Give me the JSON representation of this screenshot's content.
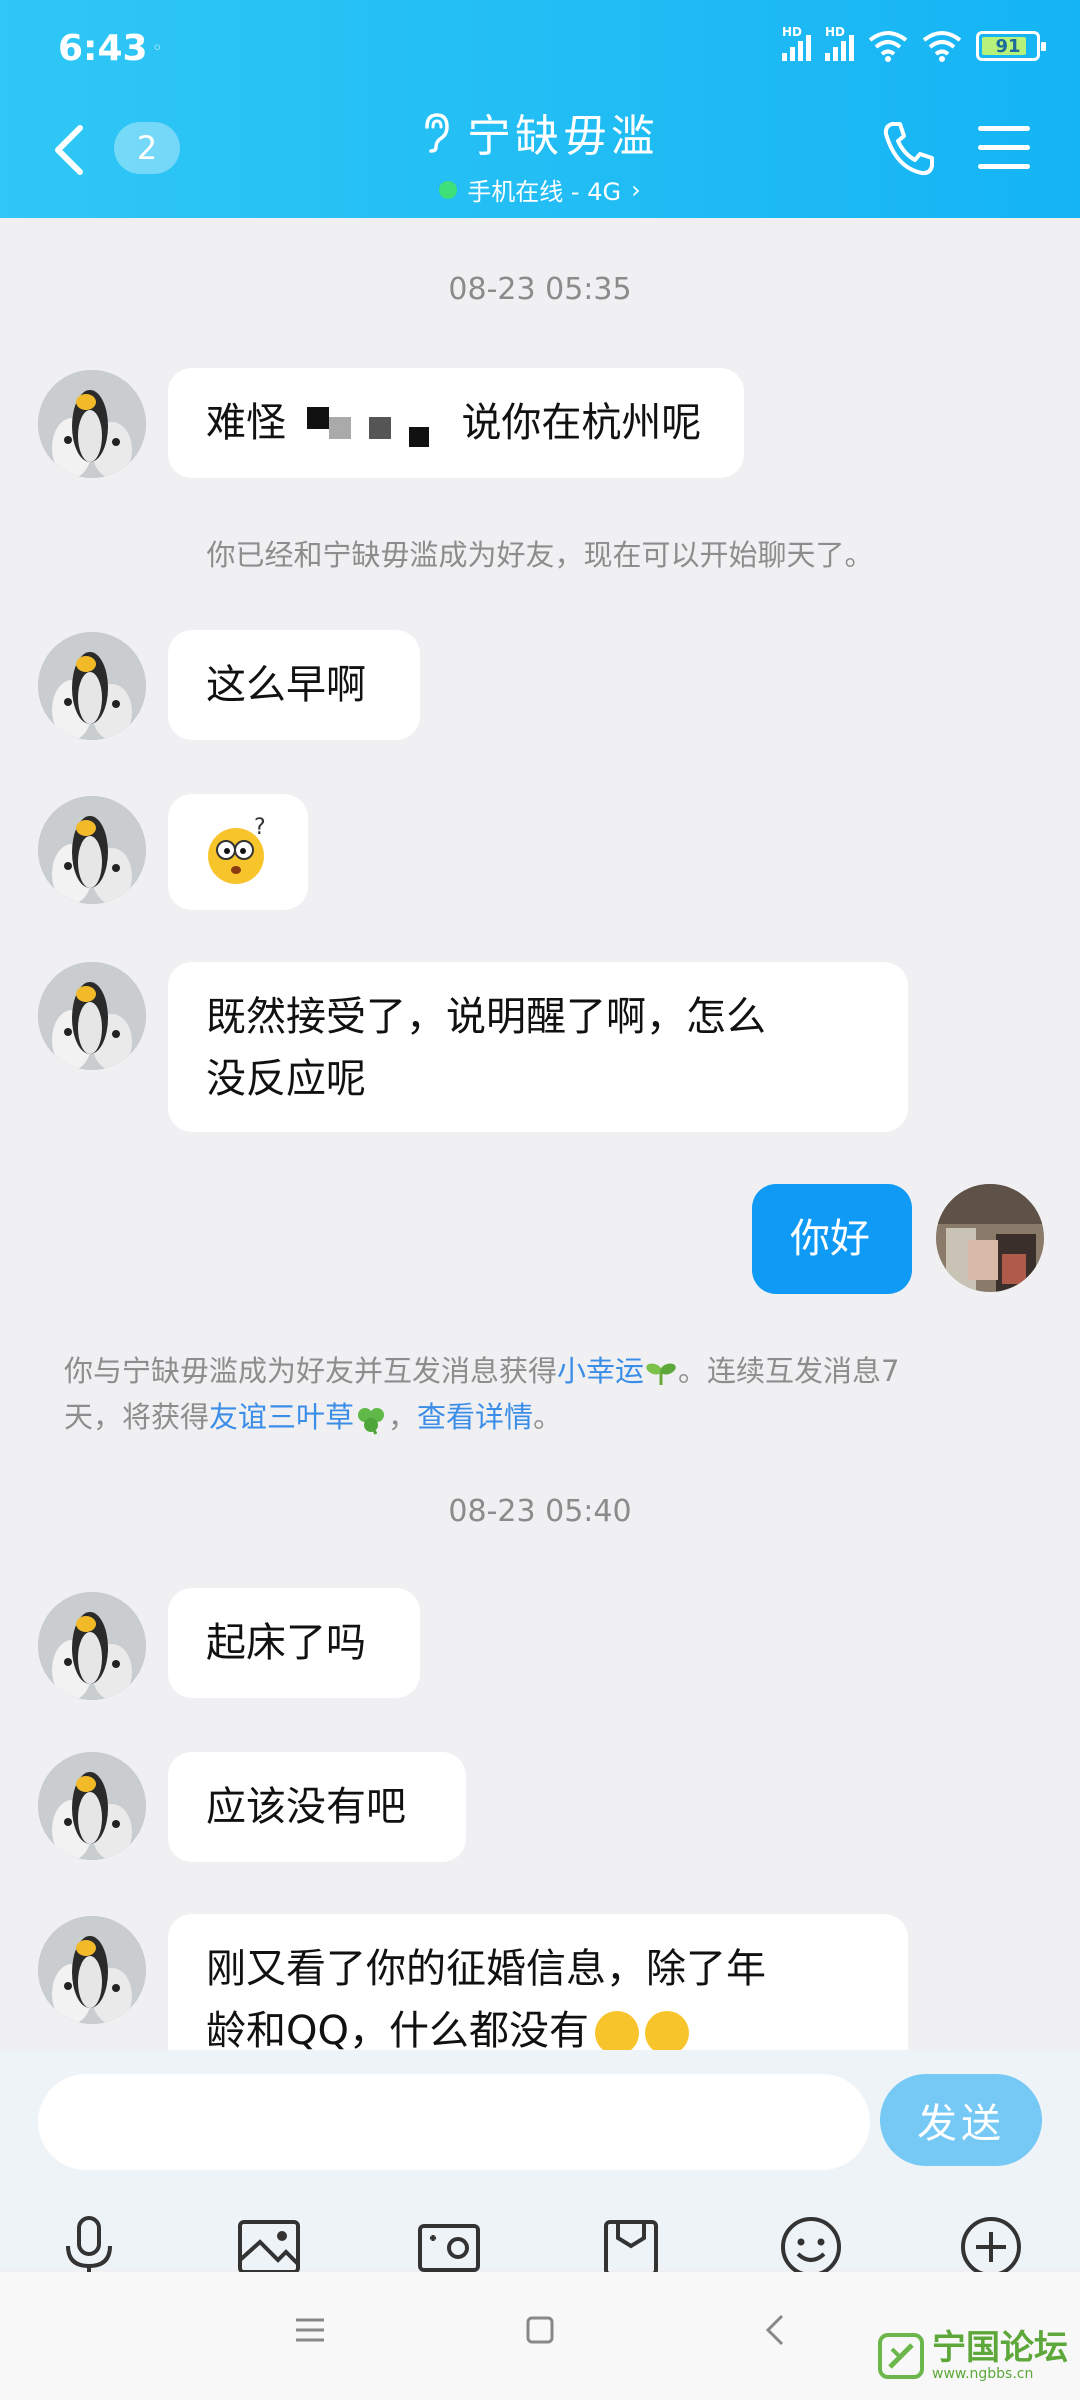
{
  "status": {
    "time": "6:43",
    "dot": "◦",
    "hd1": "HD",
    "hd2": "HD",
    "battery": "91"
  },
  "header": {
    "unread_count": "2",
    "title": "宁缺毋滥",
    "subtitle": "手机在线 - 4G",
    "subtitle_arrow": "›"
  },
  "messages": {
    "ts1": "08-23 05:35",
    "m1_a": "难怪",
    "m1_b": "说你在杭州呢",
    "sys1": "你已经和宁缺毋滥成为好友，现在可以开始聊天了。",
    "m2": "这么早啊",
    "m4_line1": "既然接受了，说明醒了啊，怎么",
    "m4_line2": "没反应呢",
    "me1": "你好",
    "sys2_a": "你与宁缺毋滥成为好友并互发消息获得",
    "sys2_link1": "小幸运",
    "sys2_b": "。连续互发消息7",
    "sys2_c": "天，将获得",
    "sys2_link2": "友谊三叶草",
    "sys2_d": "，",
    "sys2_link3": "查看详情",
    "sys2_e": "。",
    "ts2": "08-23 05:40",
    "m5": "起床了吗",
    "m6": "应该没有吧",
    "m7_line1": "刚又看了你的征婚信息，除了年",
    "m7_line2": "龄和QQ，什么都没有"
  },
  "composer": {
    "input_value": "",
    "send_label": "发送"
  },
  "icons": [
    "mic-icon",
    "image-icon",
    "camera-icon",
    "file-icon",
    "emoji-icon",
    "plus-icon"
  ],
  "watermark": {
    "name": "宁国论坛",
    "url": "www.ngbbs.cn"
  },
  "colors": {
    "header": "#15b4f4",
    "my_bubble": "#0f9af5",
    "link": "#3b8ee8",
    "send": "#76c9f5"
  }
}
